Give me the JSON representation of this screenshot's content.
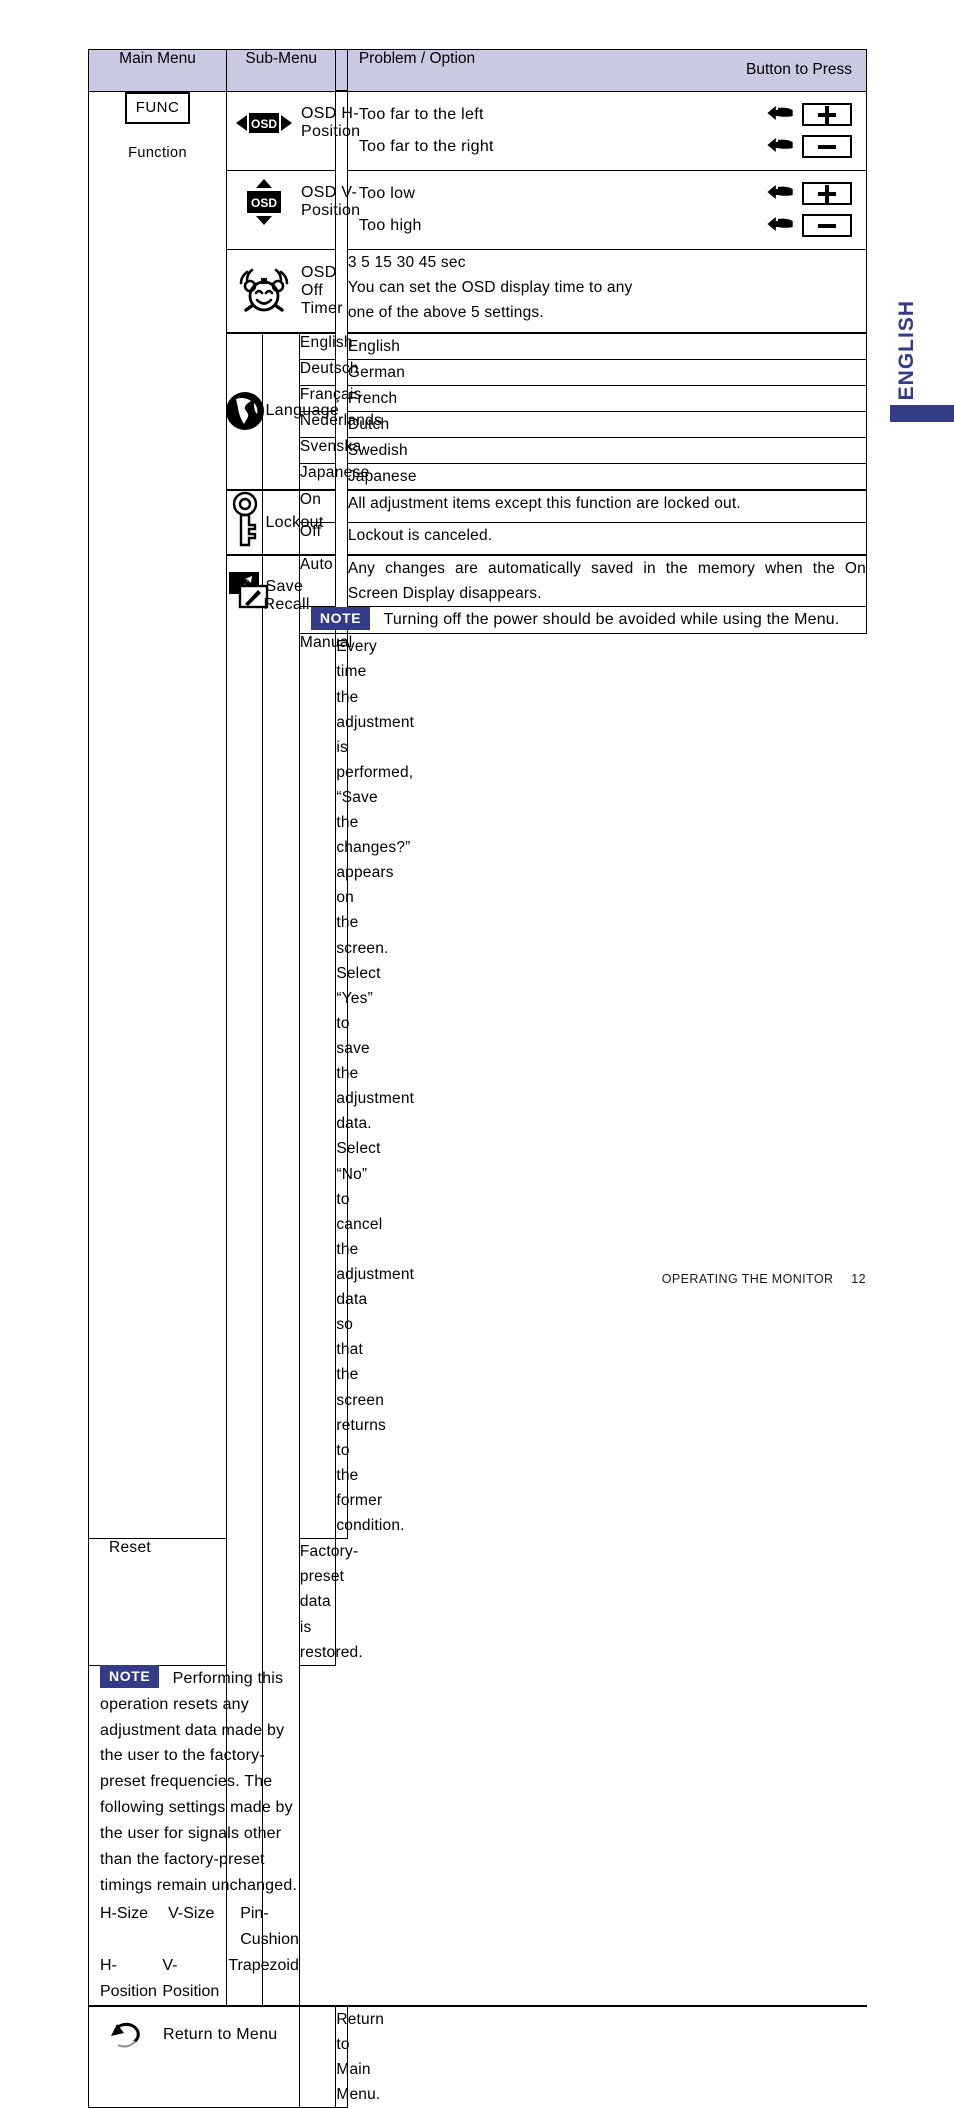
{
  "side_tab": {
    "label": "ENGLISH",
    "color": "#343c8a"
  },
  "footer": {
    "section": "OPERATING THE MONITOR",
    "page": "12"
  },
  "table": {
    "header": {
      "main_menu": "Main Menu",
      "sub_menu": "Sub-Menu",
      "problem_option": "Problem / Option",
      "button_to_press": "Button to Press"
    },
    "main_menu": {
      "button_label": "FUNC",
      "name": "Function"
    },
    "rows": {
      "osd_h_position": {
        "icon": "osd-horizontal-icon",
        "label": "OSD H-Position",
        "problems": [
          {
            "text": "Too far to the left",
            "hand": "hand-point-left-icon",
            "key": "+"
          },
          {
            "text": "Too far to the right",
            "hand": "hand-point-left-icon",
            "key": "−"
          }
        ]
      },
      "osd_v_position": {
        "icon": "osd-vertical-icon",
        "label": "OSD V-Position",
        "problems": [
          {
            "text": "Too low",
            "hand": "hand-point-left-icon",
            "key": "+"
          },
          {
            "text": "Too high",
            "hand": "hand-point-left-icon",
            "key": "−"
          }
        ]
      },
      "osd_off_timer": {
        "icon": "alarm-clock-icon",
        "label": "OSD Off Timer",
        "values": "3   5   15   30   45 sec",
        "description_line1": "You can set the OSD display time to any",
        "description_line2": "one of the above 5 settings."
      },
      "language": {
        "icon": "globe-icon",
        "label": "Language",
        "options": [
          {
            "option": "English",
            "meaning": "English"
          },
          {
            "option": "Deutsch",
            "meaning": "German"
          },
          {
            "option": "Français",
            "meaning": "French"
          },
          {
            "option": "Nederlands",
            "meaning": "Dutch"
          },
          {
            "option": "Svenska",
            "meaning": "Swedish"
          },
          {
            "option": "Japanese",
            "meaning": "Japanese"
          }
        ]
      },
      "lockout": {
        "icon": "key-icon",
        "label": "Lockout",
        "options": [
          {
            "option": "On",
            "meaning": "All adjustment items except this function are locked out."
          },
          {
            "option": "Off",
            "meaning": "Lockout is canceled."
          }
        ]
      },
      "save_recall": {
        "icon": "save-recall-icon",
        "label": "Save Recall",
        "auto": {
          "option": "Auto",
          "meaning": "Any changes are automatically saved in the memory when the On Screen Display disappears."
        },
        "note_auto": {
          "badge": "NOTE",
          "text": "Turning off the power should be avoided while using the Menu."
        },
        "manual": {
          "option": "Manual",
          "meaning": "Every time the adjustment is performed, “Save the changes?” appears on the screen. Select “Yes” to save the adjustment data. Select “No” to cancel the adjustment data so that the screen returns to the former condition."
        },
        "reset": {
          "option": "Reset",
          "meaning": "Factory-preset data is restored."
        },
        "note_reset": {
          "badge": "NOTE",
          "text": "Performing this operation resets any adjustment data made by the user to the factory-preset frequencies. The following settings made by the user for signals other than the factory-preset timings remain unchanged.",
          "items": [
            [
              "H-Size",
              "V-Size",
              "Pin-Cushion"
            ],
            [
              "H-Position",
              "V-Position",
              "Trapezoid"
            ]
          ]
        }
      },
      "return_to_menu": {
        "icon": "return-arrow-icon",
        "label": "Return to Menu",
        "description": "Return to Main Menu."
      }
    }
  }
}
